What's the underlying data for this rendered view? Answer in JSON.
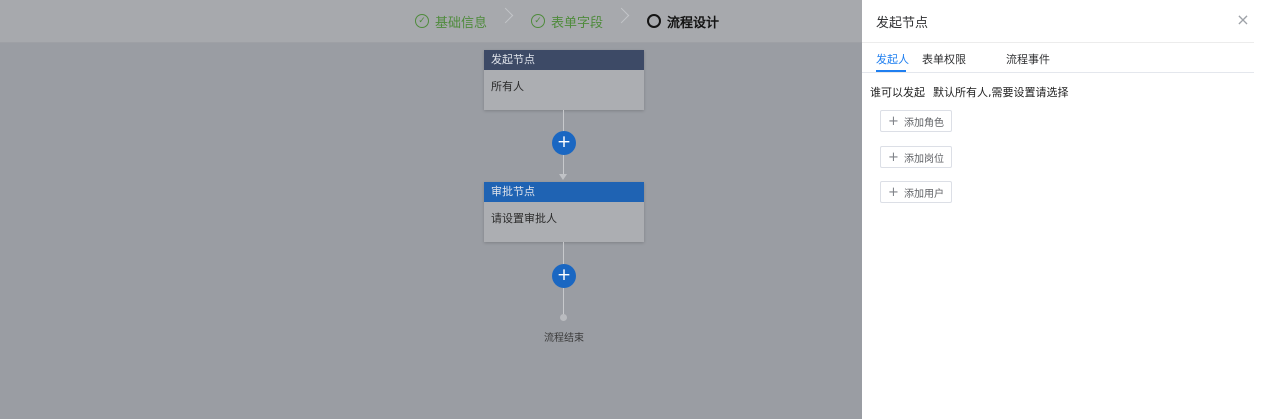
{
  "steps": [
    {
      "label": "基础信息",
      "state": "done"
    },
    {
      "label": "表单字段",
      "state": "done"
    },
    {
      "label": "流程设计",
      "state": "active"
    }
  ],
  "flow": {
    "start_node": {
      "title": "发起节点",
      "content": "所有人"
    },
    "approve_node": {
      "title": "审批节点",
      "content": "请设置审批人"
    },
    "add_symbol": "+",
    "end_label": "流程结束"
  },
  "drawer": {
    "title": "发起节点",
    "close_symbol": "×",
    "tabs": [
      "发起人",
      "表单权限",
      "流程事件"
    ],
    "active_tab": 0,
    "who_label": "谁可以发起",
    "who_hint": "默认所有人,需要设置请选择",
    "buttons": [
      {
        "label": "添加角色"
      },
      {
        "label": "添加岗位"
      },
      {
        "label": "添加用户"
      }
    ]
  },
  "colors": {
    "accent": "#1f7ff0",
    "step_done": "#4f8b3c",
    "start_header": "#3d4a66",
    "approve_header": "#1f63b3"
  }
}
